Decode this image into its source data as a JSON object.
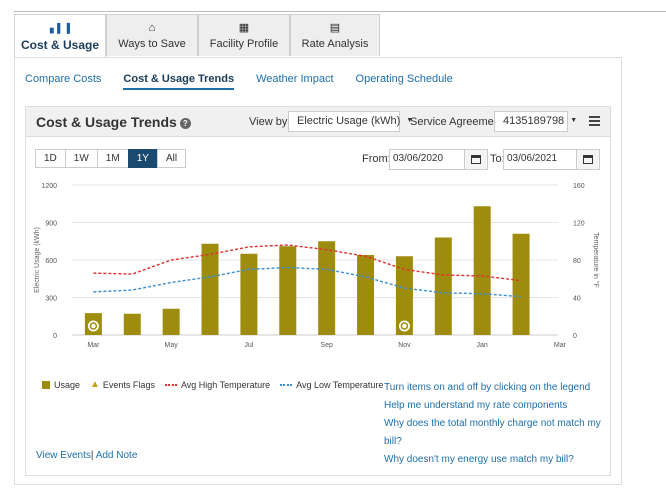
{
  "main_tabs": [
    {
      "label": "Cost & Usage",
      "icon": "bar-chart-icon",
      "active": true
    },
    {
      "label": "Ways to Save",
      "icon": "home-icon",
      "active": false
    },
    {
      "label": "Facility Profile",
      "icon": "building-icon",
      "active": false
    },
    {
      "label": "Rate Analysis",
      "icon": "calculator-icon",
      "active": false
    }
  ],
  "sub_tabs": [
    {
      "label": "Compare Costs",
      "active": false
    },
    {
      "label": "Cost & Usage Trends",
      "active": true
    },
    {
      "label": "Weather Impact",
      "active": false
    },
    {
      "label": "Operating Schedule",
      "active": false
    }
  ],
  "card": {
    "title": "Cost & Usage Trends",
    "view_by_label": "View by:",
    "view_by_value": "Electric Usage (kWh)",
    "service_label": "Service Agreement:",
    "service_value": "4135189798"
  },
  "ranges": [
    "1D",
    "1W",
    "1M",
    "1Y",
    "All"
  ],
  "active_range": "1Y",
  "dates": {
    "from_label": "From:",
    "from_value": "03/06/2020",
    "to_label": "To:",
    "to_value": "03/06/2021"
  },
  "legend": {
    "usage": "Usage",
    "events": "Events Flags",
    "high": "Avg High Temperature",
    "low": "Avg Low Temperature"
  },
  "help_links": [
    "Turn items on and off by clicking on the legend",
    "Help me understand my rate components",
    "Why does the total monthly charge not match my bill?",
    "Why doesn't my energy use match my bill?"
  ],
  "bottom_links": {
    "view_events": "View Events",
    "add_note": "Add Note"
  },
  "colors": {
    "usage": "#9e8c0e",
    "high": "#e03030",
    "low": "#3a8fd0",
    "active_tab": "#1a4a70",
    "link": "#1e6fa8"
  },
  "chart_data": {
    "type": "bar",
    "x_tick_labels": [
      "Mar",
      "May",
      "Jul",
      "Sep",
      "Nov",
      "Jan",
      "Mar"
    ],
    "ylabel_left": "Electric Usage (kWh)",
    "ylabel_right": "Temperature in °F",
    "yticks_left": [
      "1200",
      "900",
      "600",
      "300",
      "0"
    ],
    "yticks_right": [
      "160",
      "120",
      "80",
      "40",
      "0"
    ],
    "ylim_left": [
      0,
      1200
    ],
    "ylim_right": [
      0,
      160
    ],
    "series": [
      {
        "name": "Usage",
        "values": [
          175,
          170,
          210,
          730,
          650,
          710,
          750,
          640,
          630,
          780,
          1030,
          810
        ]
      },
      {
        "name": "Avg High Temperature",
        "values": [
          66,
          65,
          80,
          86,
          94,
          96,
          91,
          84,
          70,
          64,
          63,
          58
        ]
      },
      {
        "name": "Avg Low Temperature",
        "values": [
          46,
          48,
          56,
          62,
          70,
          72,
          70,
          62,
          50,
          45,
          44,
          41
        ]
      }
    ],
    "event_flags": [
      0,
      8
    ]
  }
}
